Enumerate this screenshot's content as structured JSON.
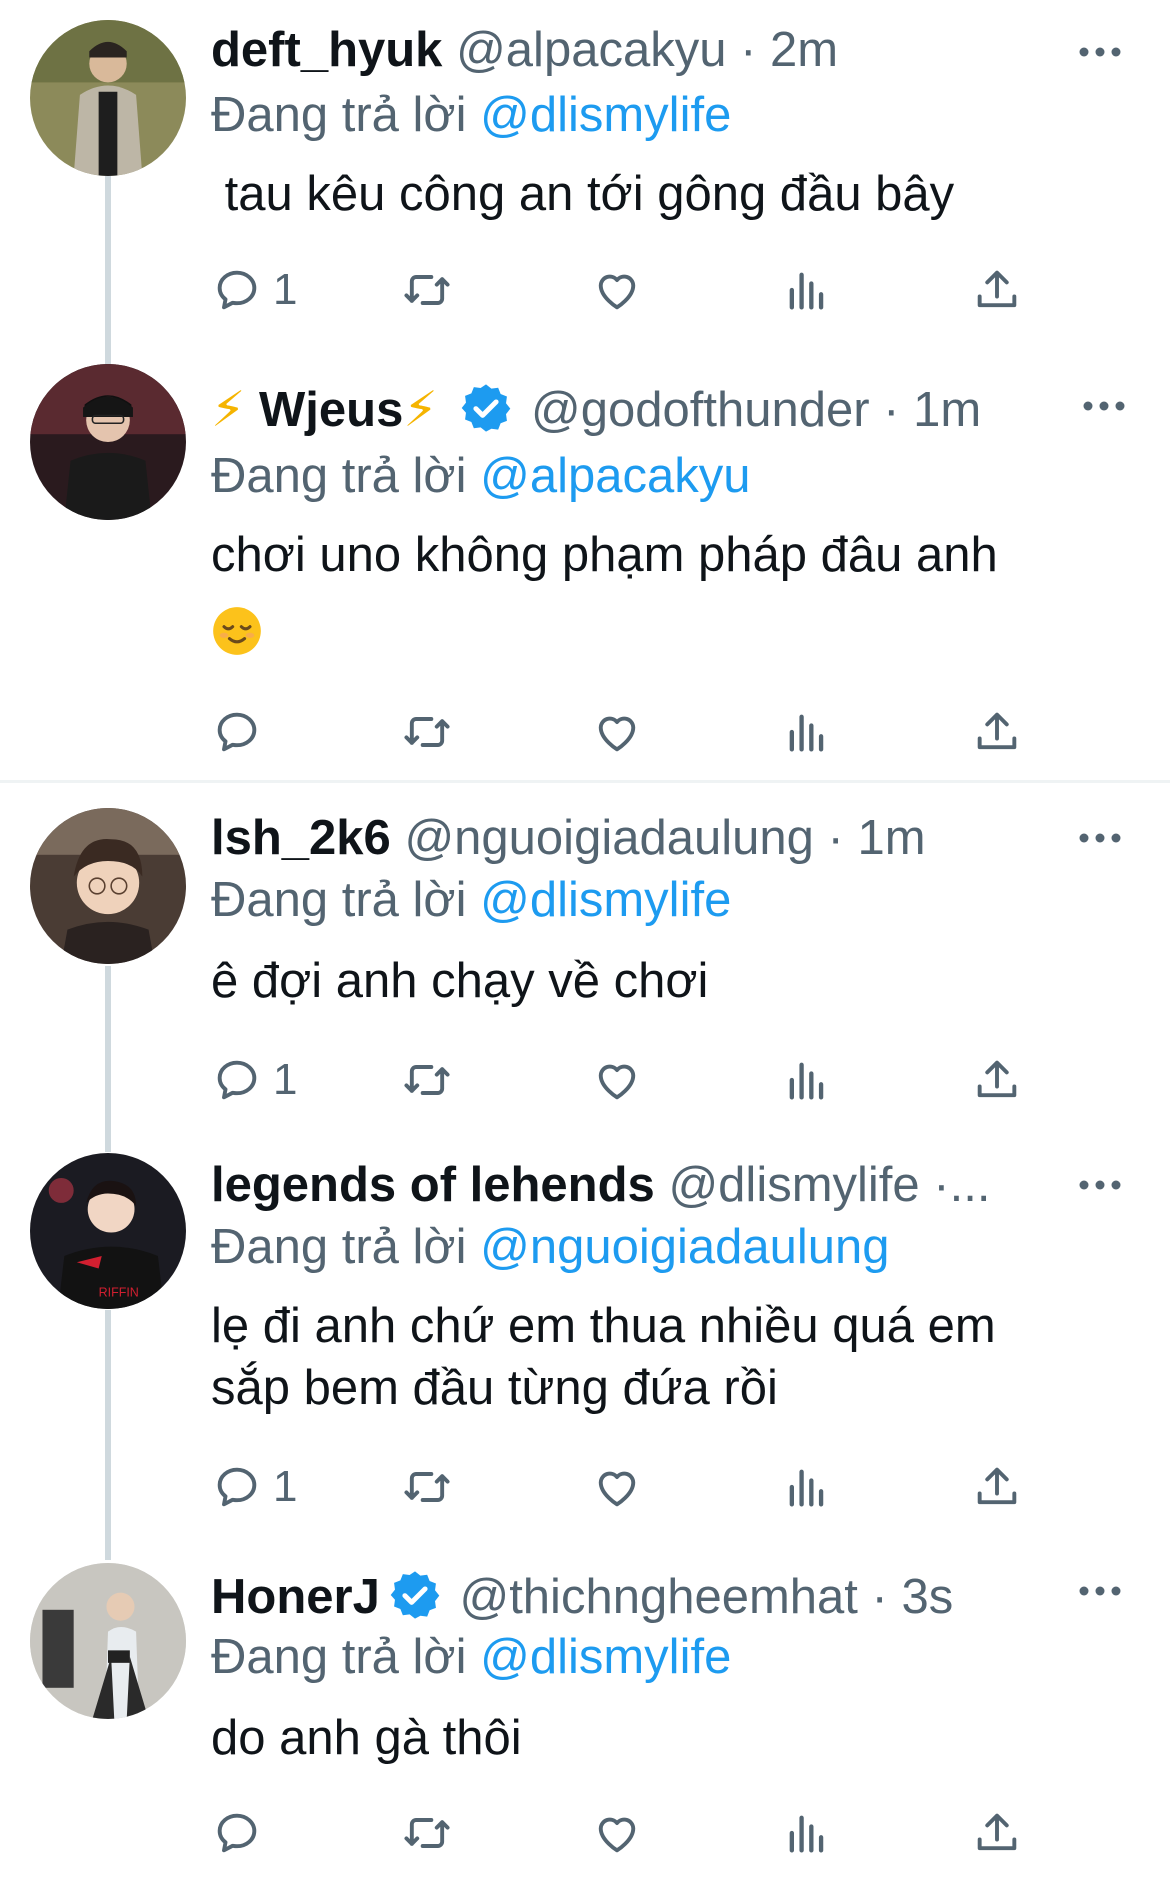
{
  "replying_prefix": "Đang trả lời",
  "tweets": [
    {
      "name": "deft_hyuk",
      "handle": "@alpacakyu",
      "time": "2m",
      "reply_to": "@dlismylife",
      "text": " tau kêu công an tới gông đầu bây",
      "reply_count": "1",
      "verified": false
    },
    {
      "name_prefix": "⚡",
      "name": "Wjeus",
      "name_suffix": "⚡",
      "handle": "@godofthunder",
      "time": "1m",
      "reply_to": "@alpacakyu",
      "text": "chơi uno không phạm pháp đâu anh",
      "emoji": "relieved-face",
      "reply_count": "",
      "verified": true
    },
    {
      "name": "lsh_2k6",
      "handle": "@nguoigiadaulung",
      "time": "1m",
      "reply_to": "@dlismylife",
      "text": "ê đợi anh chạy về chơi",
      "reply_count": "1",
      "verified": false
    },
    {
      "name": "legends of lehends",
      "handle": "@dlismylife",
      "time": "·...",
      "reply_to": "@nguoigiadaulung",
      "text_line1": "lẹ đi anh chứ em thua nhiều quá em",
      "text_line2": "sắp bem đầu từng đứa rồi",
      "reply_count": "1",
      "verified": false
    },
    {
      "name": "HonerJ",
      "handle": "@thichngheemhat",
      "time": "3s",
      "reply_to": "@dlismylife",
      "text": "do anh gà thôi",
      "reply_count": "",
      "verified": true
    }
  ],
  "colors": {
    "accent": "#1d9bf0",
    "secondary_text": "#536471",
    "thread_line": "#cfd9de",
    "bolt": "#f5b400"
  },
  "icons": [
    "reply-icon",
    "retweet-icon",
    "like-icon",
    "views-icon",
    "share-icon",
    "more-icon",
    "verified-badge-icon"
  ]
}
